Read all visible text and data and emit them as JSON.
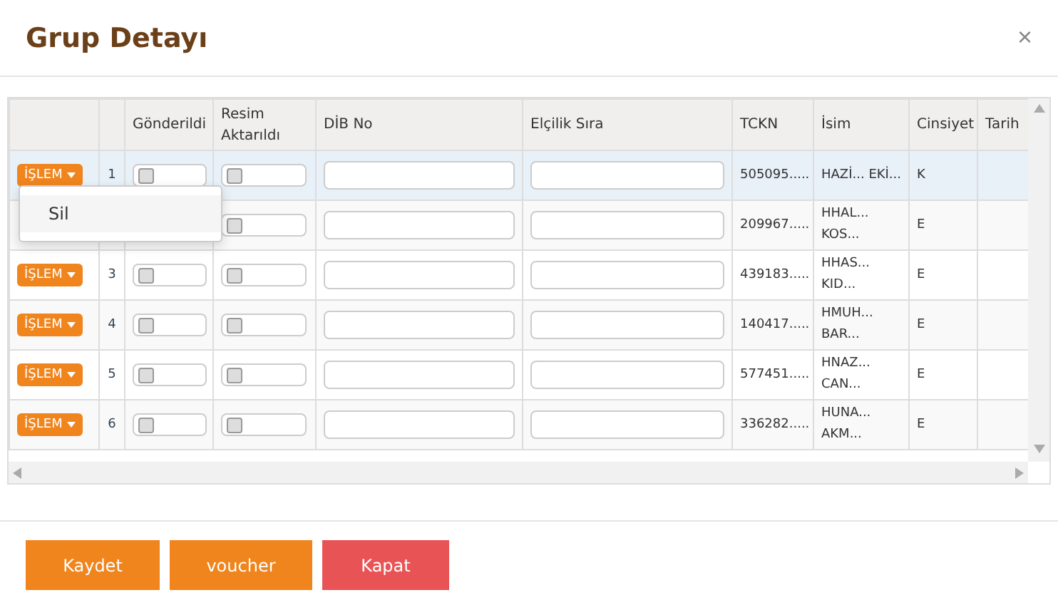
{
  "dialog": {
    "title": "Grup Detayı",
    "close": "×"
  },
  "table": {
    "columns": [
      "",
      "",
      "Gönderildi",
      "Resim Aktarıldı",
      "DİB No",
      "Elçilik Sıra",
      "TCKN",
      "İsim",
      "Cinsiyet",
      "Tarih"
    ],
    "rows": [
      {
        "action": "İŞLEM",
        "number": "1",
        "sent": false,
        "photo": false,
        "tckn": "505095.....",
        "name": [
          "HAZİ... EKİ..."
        ],
        "gender": "K",
        "selected": true
      },
      {
        "photo": false,
        "tckn": "209967.....",
        "name": [
          "HHAL...",
          "KOS..."
        ],
        "gender": "E",
        "selected": false
      },
      {
        "action": "İŞLEM",
        "number": "3",
        "sent": false,
        "photo": false,
        "tckn": "439183.....",
        "name": [
          "HHAS...",
          "KID..."
        ],
        "gender": "E",
        "selected": false
      },
      {
        "action": "İŞLEM",
        "number": "4",
        "sent": false,
        "photo": false,
        "tckn": "140417.....",
        "name": [
          "HMUH...",
          "BAR..."
        ],
        "gender": "E",
        "selected": false
      },
      {
        "action": "İŞLEM",
        "number": "5",
        "sent": false,
        "photo": false,
        "tckn": "577451.....",
        "name": [
          "HNAZ...",
          "CAN..."
        ],
        "gender": "E",
        "selected": false
      },
      {
        "action": "İŞLEM",
        "number": "6",
        "sent": false,
        "photo": false,
        "tckn": "336282.....",
        "name": [
          "HUNA...",
          "AKM..."
        ],
        "gender": "E",
        "selected": false
      }
    ],
    "menu": {
      "items": [
        "Sil"
      ]
    }
  },
  "buttons": [
    {
      "label": "Kaydet",
      "kind": "primary"
    },
    {
      "label": "voucher",
      "kind": "primary"
    },
    {
      "label": "Kapat",
      "kind": "danger"
    }
  ]
}
